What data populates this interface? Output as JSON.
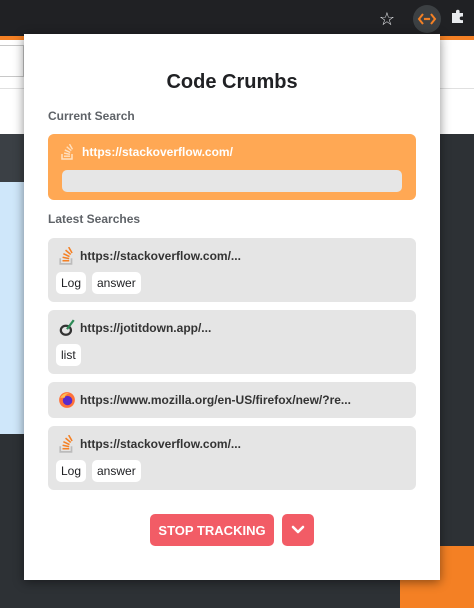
{
  "browser": {
    "star_icon": "star-icon",
    "extension_icon": "code-crumbs-extension-icon",
    "puzzle_icon": "puzzle-icon",
    "accent": "#f48024"
  },
  "popup": {
    "title": "Code Crumbs",
    "current_search_label": "Current Search",
    "current_search": {
      "url": "https://stackoverflow.com/",
      "icon": "stackoverflow-icon",
      "input_value": ""
    },
    "latest_searches_label": "Latest Searches",
    "latest_searches": [
      {
        "url": "https://stackoverflow.com/...",
        "icon": "stackoverflow-icon",
        "tags": [
          "Log",
          "answer"
        ]
      },
      {
        "url": "https://jotitdown.app/...",
        "icon": "jotitdown-icon",
        "tags": [
          "list"
        ]
      },
      {
        "url": "https://www.mozilla.org/en-US/firefox/new/?re...",
        "icon": "firefox-icon",
        "tags": []
      },
      {
        "url": "https://stackoverflow.com/...",
        "icon": "stackoverflow-icon",
        "tags": [
          "Log",
          "answer"
        ]
      }
    ],
    "stop_button_label": "STOP TRACKING",
    "dropdown_icon": "chevron-down-icon",
    "colors": {
      "current_card": "#ffa854",
      "card_bg": "#e5e5e5",
      "stop_button": "#f25c66"
    }
  }
}
